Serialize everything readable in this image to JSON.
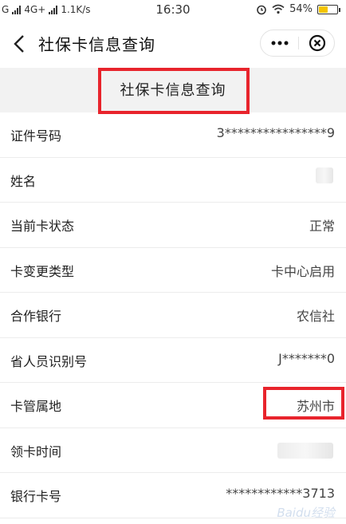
{
  "status_bar": {
    "carrier_g": "G",
    "network": "4G+",
    "speed": "1.1K/s",
    "time": "16:30",
    "battery_percent": "54%",
    "battery_level": 0.54,
    "icons": [
      "signal-icon",
      "alarm-icon",
      "wifi-icon",
      "battery-icon"
    ]
  },
  "navbar": {
    "title": "社保卡信息查询",
    "icons": [
      "back-arrow-icon",
      "more-dots-icon",
      "close-circle-icon"
    ]
  },
  "heading": "社保卡信息查询",
  "rows": [
    {
      "label": "证件号码",
      "value": "3****************9"
    },
    {
      "label": "姓名",
      "value": ""
    },
    {
      "label": "当前卡状态",
      "value": "正常"
    },
    {
      "label": "卡变更类型",
      "value": "卡中心启用"
    },
    {
      "label": "合作银行",
      "value": "农信社"
    },
    {
      "label": "省人员识别号",
      "value": "J*******0"
    },
    {
      "label": "卡管属地",
      "value": "苏州市"
    },
    {
      "label": "领卡时间",
      "value": ""
    },
    {
      "label": "银行卡号",
      "value": "************3713"
    }
  ],
  "colors": {
    "highlight": "#e8242c",
    "band": "#f2f2f2",
    "battery": "#f5c400"
  },
  "watermark": "Baidu经验"
}
